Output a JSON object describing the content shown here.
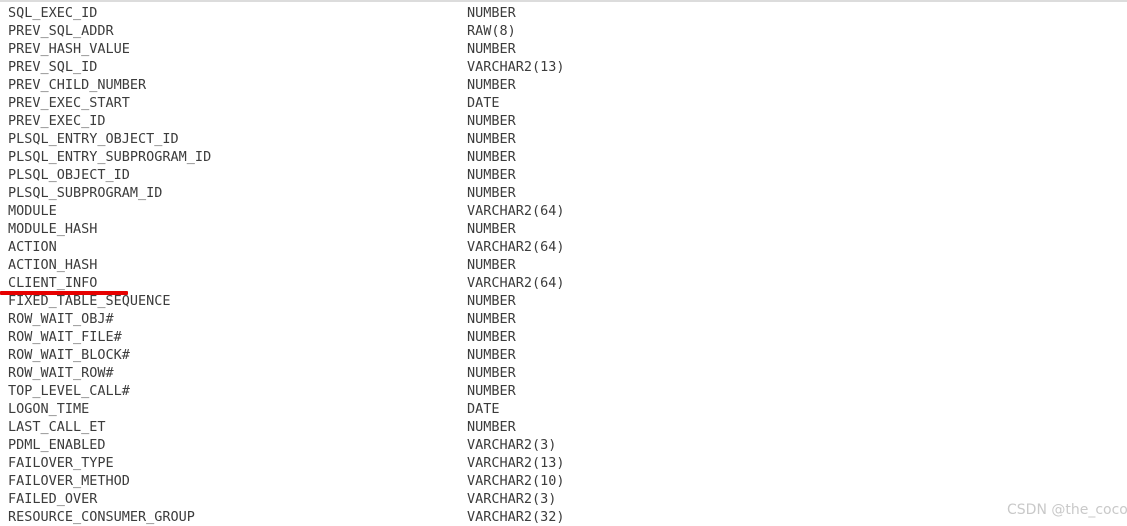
{
  "view": {
    "kind": "database-column-listing",
    "top_rule_color": "#dcdcdc",
    "text_color": "#3c3c3c",
    "background_color": "#ffffff"
  },
  "annotation": {
    "type": "underline",
    "color": "#e60000",
    "targets_row_index": 14,
    "target_column_name": "CLIENT_INFO"
  },
  "watermark": {
    "text": "CSDN @the_coco",
    "color": "#c9c9c9"
  },
  "columns": [
    {
      "name": "SQL_EXEC_ID",
      "type": "NUMBER"
    },
    {
      "name": "PREV_SQL_ADDR",
      "type": "RAW(8)"
    },
    {
      "name": "PREV_HASH_VALUE",
      "type": "NUMBER"
    },
    {
      "name": "PREV_SQL_ID",
      "type": "VARCHAR2(13)"
    },
    {
      "name": "PREV_CHILD_NUMBER",
      "type": "NUMBER"
    },
    {
      "name": "PREV_EXEC_START",
      "type": "DATE"
    },
    {
      "name": "PREV_EXEC_ID",
      "type": "NUMBER"
    },
    {
      "name": "PLSQL_ENTRY_OBJECT_ID",
      "type": "NUMBER"
    },
    {
      "name": "PLSQL_ENTRY_SUBPROGRAM_ID",
      "type": "NUMBER"
    },
    {
      "name": "PLSQL_OBJECT_ID",
      "type": "NUMBER"
    },
    {
      "name": "PLSQL_SUBPROGRAM_ID",
      "type": "NUMBER"
    },
    {
      "name": "MODULE",
      "type": "VARCHAR2(64)"
    },
    {
      "name": "MODULE_HASH",
      "type": "NUMBER"
    },
    {
      "name": "ACTION",
      "type": "VARCHAR2(64)"
    },
    {
      "name": "ACTION_HASH",
      "type": "NUMBER"
    },
    {
      "name": "CLIENT_INFO",
      "type": "VARCHAR2(64)"
    },
    {
      "name": "FIXED_TABLE_SEQUENCE",
      "type": "NUMBER"
    },
    {
      "name": "ROW_WAIT_OBJ#",
      "type": "NUMBER"
    },
    {
      "name": "ROW_WAIT_FILE#",
      "type": "NUMBER"
    },
    {
      "name": "ROW_WAIT_BLOCK#",
      "type": "NUMBER"
    },
    {
      "name": "ROW_WAIT_ROW#",
      "type": "NUMBER"
    },
    {
      "name": "TOP_LEVEL_CALL#",
      "type": "NUMBER"
    },
    {
      "name": "LOGON_TIME",
      "type": "DATE"
    },
    {
      "name": "LAST_CALL_ET",
      "type": "NUMBER"
    },
    {
      "name": "PDML_ENABLED",
      "type": "VARCHAR2(3)"
    },
    {
      "name": "FAILOVER_TYPE",
      "type": "VARCHAR2(13)"
    },
    {
      "name": "FAILOVER_METHOD",
      "type": "VARCHAR2(10)"
    },
    {
      "name": "FAILED_OVER",
      "type": "VARCHAR2(3)"
    },
    {
      "name": "RESOURCE_CONSUMER_GROUP",
      "type": "VARCHAR2(32)"
    }
  ]
}
